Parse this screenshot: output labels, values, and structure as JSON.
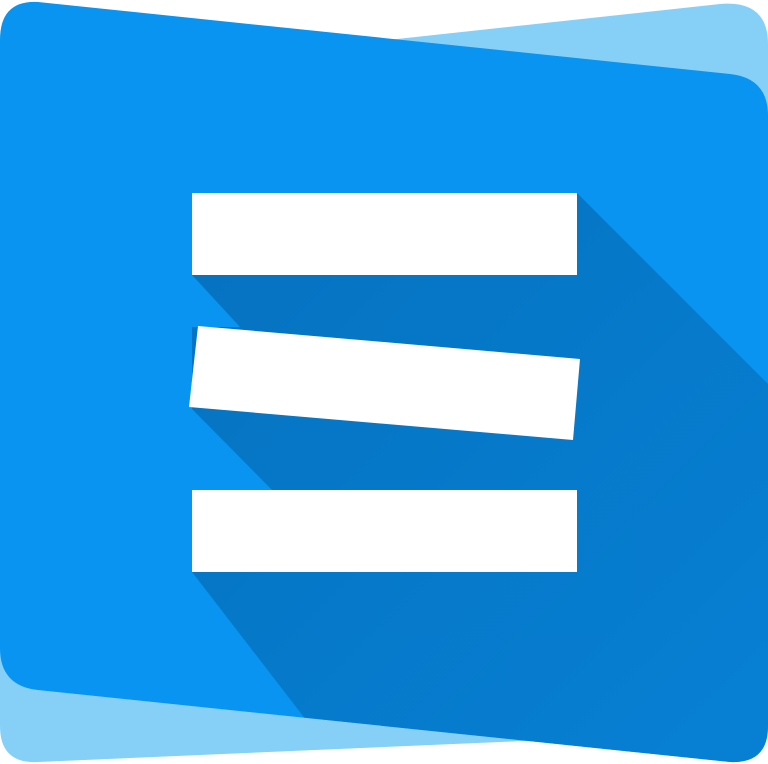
{
  "logo": {
    "icon": "hamburger-menu-icon",
    "colors": {
      "back_card": "#86d0f7",
      "front_card": "#0894f0",
      "long_shadow": "#0670bd",
      "bars": "#ffffff"
    }
  }
}
